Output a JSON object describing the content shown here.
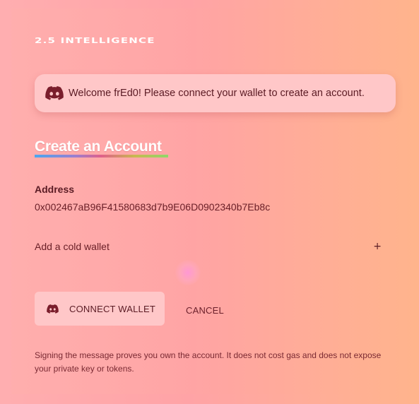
{
  "brand": {
    "title": "2.5 INTELLIGENCE"
  },
  "welcome": {
    "icon": "discord-icon",
    "message": "Welcome frEd0! Please connect your wallet to create an account."
  },
  "form": {
    "title": "Create an Account",
    "address_label": "Address",
    "address_value": "0x002467aB96F41580683d7b9E06D0902340b7Eb8c",
    "cold_wallet_label": "Add a cold wallet",
    "cold_wallet_icon": "+"
  },
  "actions": {
    "connect_icon": "discord-icon",
    "connect_label": "CONNECT WALLET",
    "cancel_label": "CANCEL"
  },
  "disclaimer": "Signing the message proves you own the account. It does not cost gas and does not expose your private key or tokens.",
  "colors": {
    "accent_text": "#5a1b24",
    "panel_bg": "#ffc7c8",
    "discord_icon": "#7a1e2c"
  }
}
